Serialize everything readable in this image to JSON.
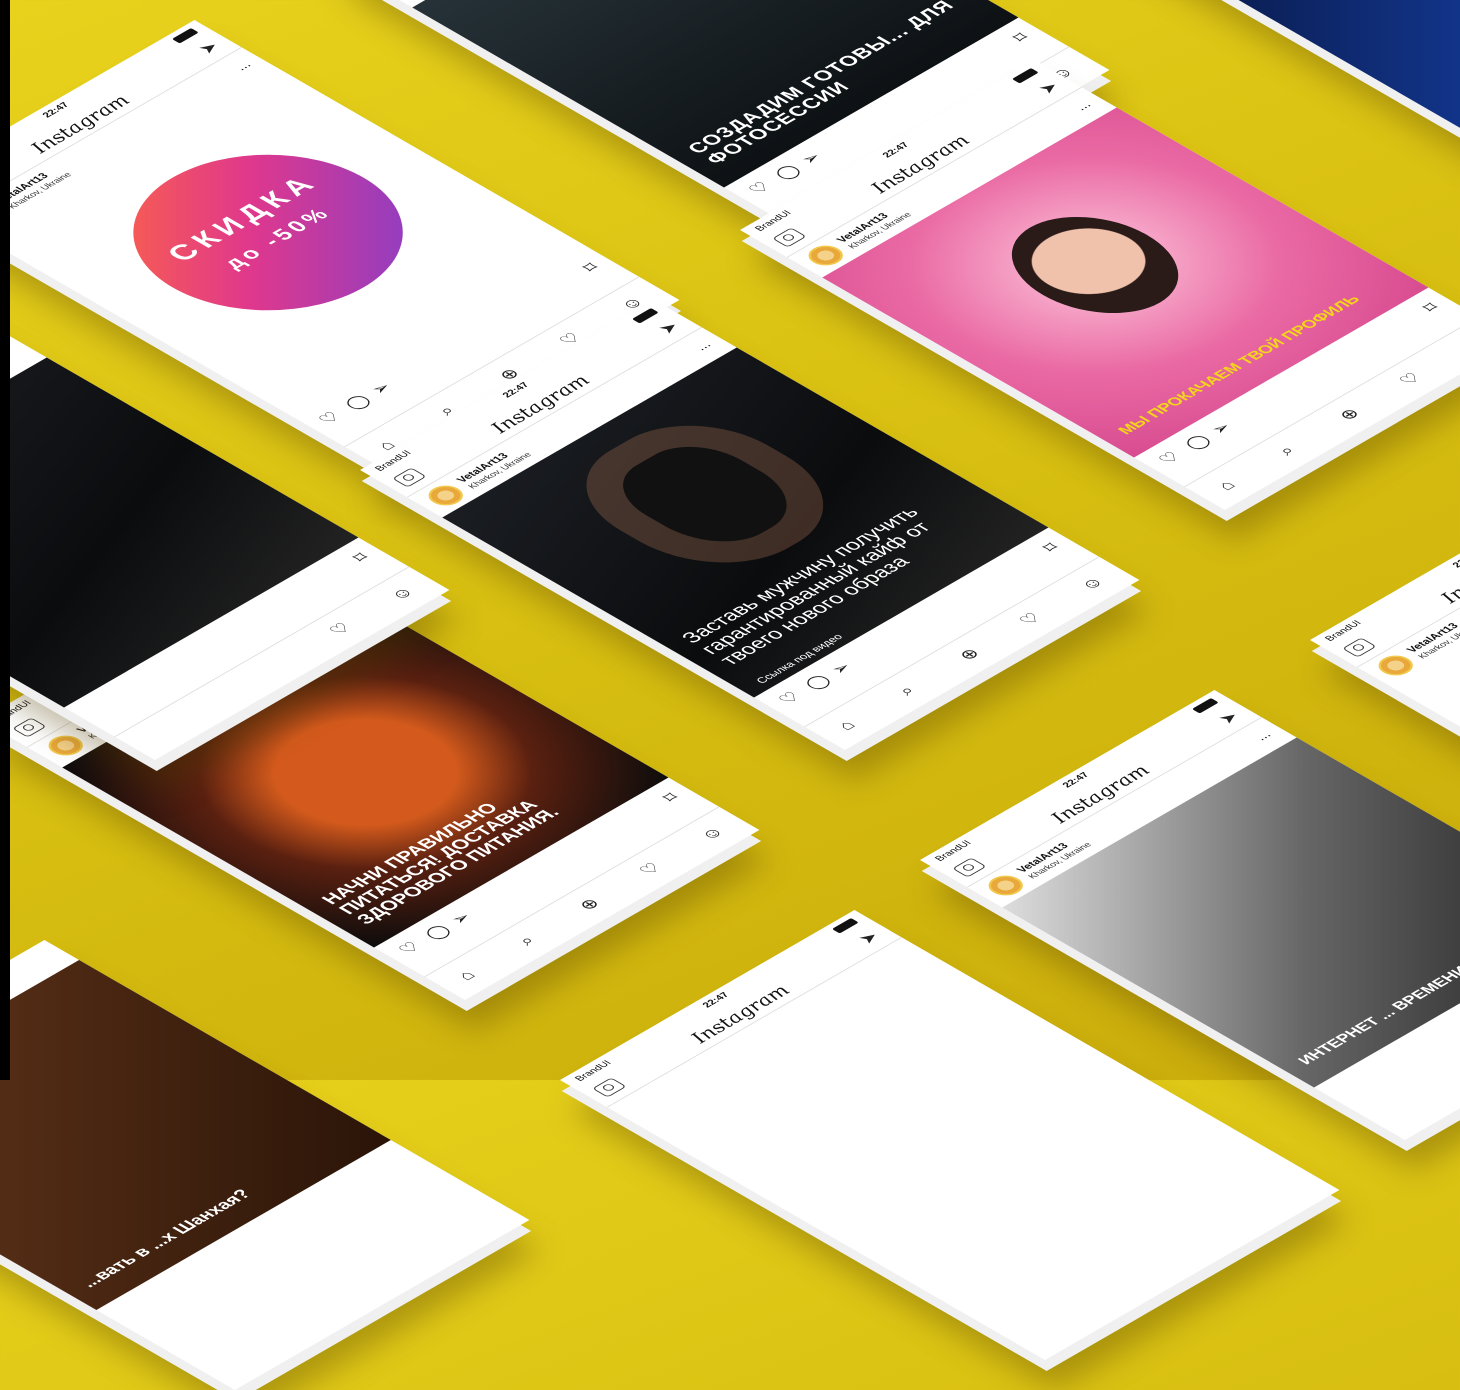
{
  "app": {
    "carrier": "BrandUI",
    "time": "22:47",
    "logo": "Instagram",
    "username": "VetalArt13",
    "location": "Kharkov, Ukraine",
    "more": "...",
    "icons": {
      "camera": "camera-icon",
      "send": "send-icon",
      "like": "heart-icon",
      "comment": "comment-icon",
      "share": "share-icon",
      "bookmark": "bookmark-icon",
      "home": "home-icon",
      "search": "search-icon",
      "add": "add-icon",
      "activity": "heart-icon",
      "profile": "profile-icon"
    },
    "glyphs": {
      "send": "➤",
      "like": "♡",
      "comment": "◯",
      "share": "➢",
      "bookmark": "⌑",
      "home": "⌂",
      "search": "⌕",
      "add": "⊕",
      "activity": "♡",
      "profile": "☺"
    }
  },
  "posts": [
    {
      "type": "sale",
      "title": "СКИДКА",
      "subtitle": "до -50%"
    },
    {
      "type": "photo",
      "caption": "СОЗДАДИМ ГОТОВЫ... ДЛЯ ФОТОСЕССИИ"
    },
    {
      "type": "pink",
      "caption": "МЫ ПРОКАЧАЕМ ТВОЙ ПРОФИЛЬ"
    },
    {
      "type": "dark",
      "caption": "Заставь мужчину получить гарантированный кайф от твоего нового образа",
      "link": "Ссылка под видео"
    },
    {
      "type": "lobster",
      "caption": "НАЧНИ ПРАВИЛЬНО ПИТАТЬСЯ! ДОСТАВКА ЗДОРОВОГО ПИТАНИЯ."
    },
    {
      "type": "bw",
      "caption": "ИНТЕРНЕТ ... ВРЕМЕНИ"
    },
    {
      "type": "blue"
    },
    {
      "type": "brown",
      "caption": "...вать в ...х Шанхая?"
    }
  ],
  "colors": {
    "background": "#e2c814",
    "sale_gradient": [
      "#ff6a3d",
      "#e0388c",
      "#7b3fd0"
    ],
    "pink_caption": "#f5d51a"
  }
}
